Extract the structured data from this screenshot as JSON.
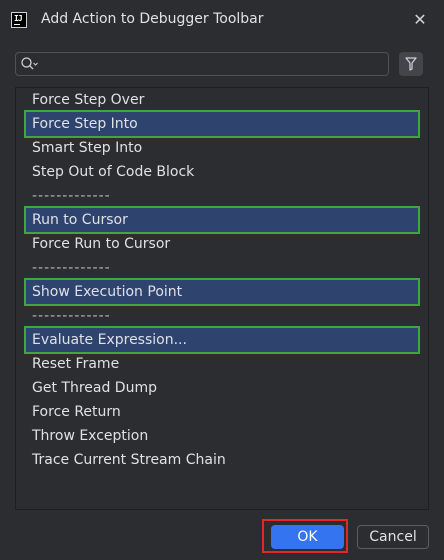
{
  "window": {
    "title": "Add Action to Debugger Toolbar",
    "app_icon": "intellij-icon",
    "close_icon": "close-icon"
  },
  "search": {
    "value": "",
    "placeholder": "",
    "icon": "search-icon",
    "filter_icon": "filter-icon"
  },
  "actions": [
    {
      "label": "Force Step Over",
      "selected": false
    },
    {
      "label": "Force Step Into",
      "selected": true
    },
    {
      "label": "Smart Step Into",
      "selected": false
    },
    {
      "label": "Step Out of Code Block",
      "selected": false
    },
    {
      "label": "-------------",
      "separator": true
    },
    {
      "label": "Run to Cursor",
      "selected": true
    },
    {
      "label": "Force Run to Cursor",
      "selected": false
    },
    {
      "label": "-------------",
      "separator": true
    },
    {
      "label": "Show Execution Point",
      "selected": true
    },
    {
      "label": "-------------",
      "separator": true
    },
    {
      "label": "Evaluate Expression...",
      "selected": true
    },
    {
      "label": "Reset Frame",
      "selected": false
    },
    {
      "label": "Get Thread Dump",
      "selected": false
    },
    {
      "label": "Force Return",
      "selected": false
    },
    {
      "label": "Throw Exception",
      "selected": false
    },
    {
      "label": "Trace Current Stream Chain",
      "selected": false
    }
  ],
  "buttons": {
    "ok": "OK",
    "cancel": "Cancel"
  },
  "colors": {
    "background": "#2b2d30",
    "selection": "#2e436e",
    "highlight_green": "#3fa640",
    "highlight_red": "#e5262b",
    "primary": "#3574f0"
  }
}
